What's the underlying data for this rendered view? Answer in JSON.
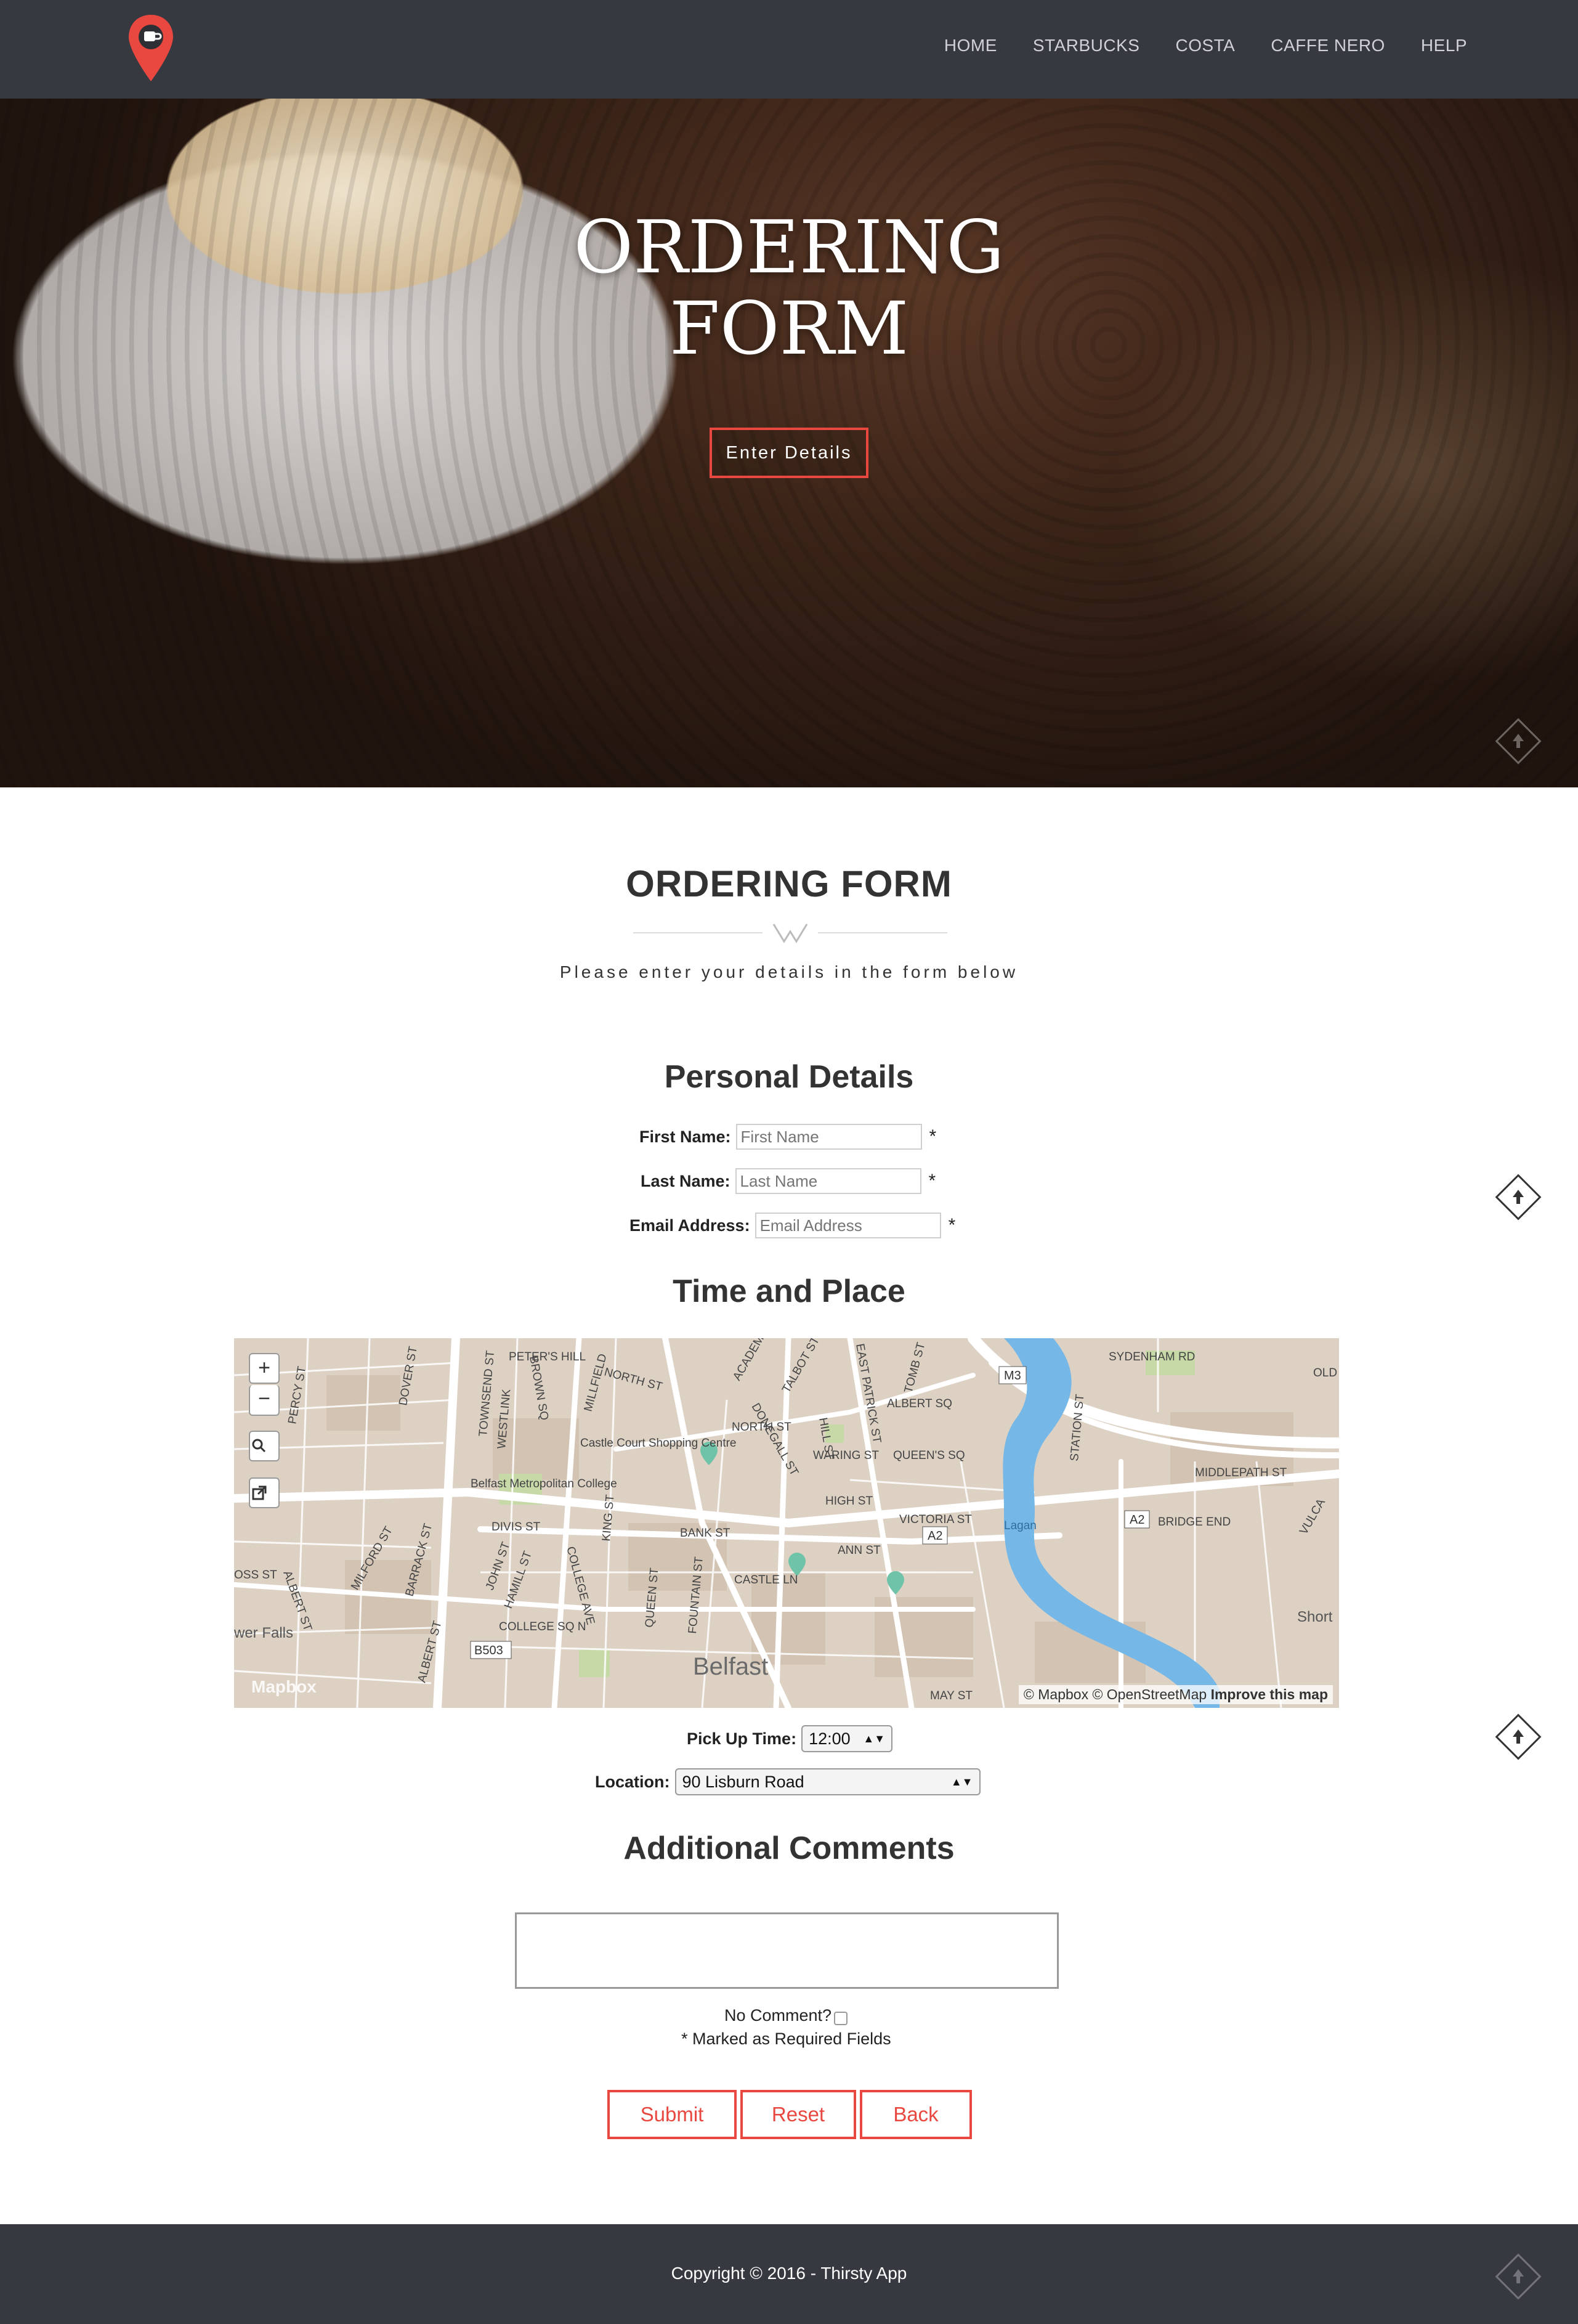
{
  "nav": {
    "items": [
      "HOME",
      "STARBUCKS",
      "COSTA",
      "CAFFE NERO",
      "HELP"
    ]
  },
  "hero": {
    "title_line1": "ORDERING",
    "title_line2": "FORM",
    "button": "Enter Details"
  },
  "section": {
    "title": "ORDERING FORM",
    "subtitle": "Please enter your details in the form below"
  },
  "personal": {
    "heading": "Personal Details",
    "first_name_label": "First Name:",
    "first_name_placeholder": "First Name",
    "last_name_label": "Last Name:",
    "last_name_placeholder": "Last Name",
    "email_label": "Email Address:",
    "email_placeholder": "Email Address",
    "required_mark": "*"
  },
  "time_place": {
    "heading": "Time and Place",
    "pickup_label": "Pick Up Time:",
    "pickup_value": "12:00",
    "location_label": "Location:",
    "location_value": "90 Lisburn Road"
  },
  "map": {
    "zoom_in": "+",
    "zoom_out": "−",
    "attribution_a": "© Mapbox © OpenStreetMap",
    "attribution_b": "Improve this map",
    "logo": "Mapbox",
    "labels": {
      "city": "Belfast",
      "castle_court": "Castle Court Shopping Centre",
      "met_college": "Belfast Metropolitan College",
      "divis": "DIVIS ST",
      "bank": "BANK ST",
      "castle": "CASTLE LN",
      "ann": "ANN ST",
      "high": "HIGH ST",
      "waring": "WARING ST",
      "north": "NORTH ST",
      "queens_sq": "QUEEN'S SQ",
      "albert_sq": "ALBERT SQ",
      "victoria": "VICTORIA ST",
      "college_sq": "COLLEGE SQ N",
      "middlepath": "MIDDLEPATH ST",
      "bridge_end": "BRIDGE END",
      "sydenham": "SYDENHAM RD",
      "lagan": "Lagan",
      "m3": "M3",
      "a2a": "A2",
      "a2b": "A2",
      "b503": "B503",
      "falls": "wer Falls",
      "short": "Short",
      "old": "OLD",
      "may": "MAY ST",
      "peters": "PETER'S HILL",
      "millfield": "MILLFIELD",
      "donegall": "DONEGALL ST",
      "talbot": "TALBOT ST",
      "academy": "ACADEMY",
      "hill": "HILL ST",
      "east_patrick": "EAST PATRICK ST",
      "tomb": "TOMB ST",
      "station": "STATION ST",
      "dover": "DOVER ST",
      "townsend": "TOWNSEND ST",
      "westlink": "WESTLINK",
      "brown_sq": "BROWN SQ",
      "percy": "PERCY ST",
      "milford": "MILFORD ST",
      "albert": "ALBERT ST",
      "barrack": "BARRACK ST",
      "john": "JOHN ST",
      "hamill": "HAMILL ST",
      "college_ave": "COLLEGE AVE",
      "queen": "QUEEN ST",
      "fountain": "FOUNTAIN ST",
      "king": "KING ST",
      "vulca": "VULCA",
      "oss": "OSS ST",
      "albert_st2": "ALBERT ST",
      "north_st2": "NORTH ST"
    }
  },
  "comments": {
    "heading": "Additional Comments",
    "no_comment_label": "No Comment?",
    "required_note": "* Marked as Required Fields"
  },
  "buttons": {
    "submit": "Submit",
    "reset": "Reset",
    "back": "Back"
  },
  "footer": {
    "text": "Copyright © 2016 - Thirsty App"
  },
  "colors": {
    "nav_bg": "#363940",
    "accent": "#e8483f",
    "water": "#75b7e6",
    "map_land": "#ddd1c4",
    "marker": "#6fc3a8"
  }
}
